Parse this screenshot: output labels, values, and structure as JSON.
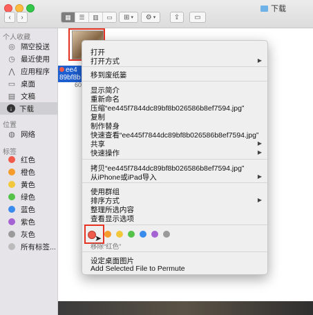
{
  "window": {
    "title": "下载"
  },
  "toolbar": {
    "back": "‹",
    "forward": "›",
    "view_icon": "⊞",
    "settings_icon": "⚙",
    "share_icon": "⇪",
    "tag_icon": "▭"
  },
  "sidebar": {
    "favorites_header": "个人收藏",
    "favorites": [
      {
        "label": "隔空投送",
        "icon": "airdrop-icon"
      },
      {
        "label": "最近使用",
        "icon": "clock-icon"
      },
      {
        "label": "应用程序",
        "icon": "apps-icon"
      },
      {
        "label": "桌面",
        "icon": "desktop-icon"
      },
      {
        "label": "文稿",
        "icon": "doc-icon"
      },
      {
        "label": "下载",
        "icon": "download-icon",
        "selected": true
      }
    ],
    "locations_header": "位置",
    "locations": [
      {
        "label": "网络",
        "icon": "globe-icon"
      }
    ],
    "tags_header": "标签",
    "tags": [
      {
        "label": "红色",
        "color": "#f05a4a"
      },
      {
        "label": "橙色",
        "color": "#f59c2d"
      },
      {
        "label": "黄色",
        "color": "#f2c73a"
      },
      {
        "label": "绿色",
        "color": "#55c24a"
      },
      {
        "label": "蓝色",
        "color": "#3a8bee"
      },
      {
        "label": "紫色",
        "color": "#a562d3"
      },
      {
        "label": "灰色",
        "color": "#9a9a9a"
      },
      {
        "label": "所有标签...",
        "color": "#bbbbbb"
      }
    ]
  },
  "file": {
    "name_line1": "ee4",
    "name_line2": "89bf8b",
    "sub": "60"
  },
  "menu": {
    "open": "打开",
    "open_with": "打开方式",
    "move_trash": "移到废纸篓",
    "get_info": "显示简介",
    "rename": "重新命名",
    "compress": "压缩“ee445f7844dc89bf8b026586b8ef7594.jpg”",
    "copy": "复制",
    "make_alias": "制作替身",
    "quick_look": "快速查看“ee445f7844dc89bf8b026586b8ef7594.jpg”",
    "share": "共享",
    "quick_actions": "快速操作",
    "copy_item": "拷贝“ee445f7844dc89bf8b026586b8ef7594.jpg”",
    "import_iphone": "从iPhone或iPad导入",
    "use_groups": "使用群组",
    "sort_by": "排序方式",
    "clean_up": "整理所选内容",
    "show_view_options": "查看显示选项",
    "tag_colors": [
      "#f05a4a",
      "#f59c2d",
      "#f2c73a",
      "#55c24a",
      "#3a8bee",
      "#a562d3",
      "#9a9a9a"
    ],
    "remove_tag": "移除“红色”",
    "set_desktop": "设定桌面图片",
    "add_permute": "Add Selected File to Permute"
  }
}
